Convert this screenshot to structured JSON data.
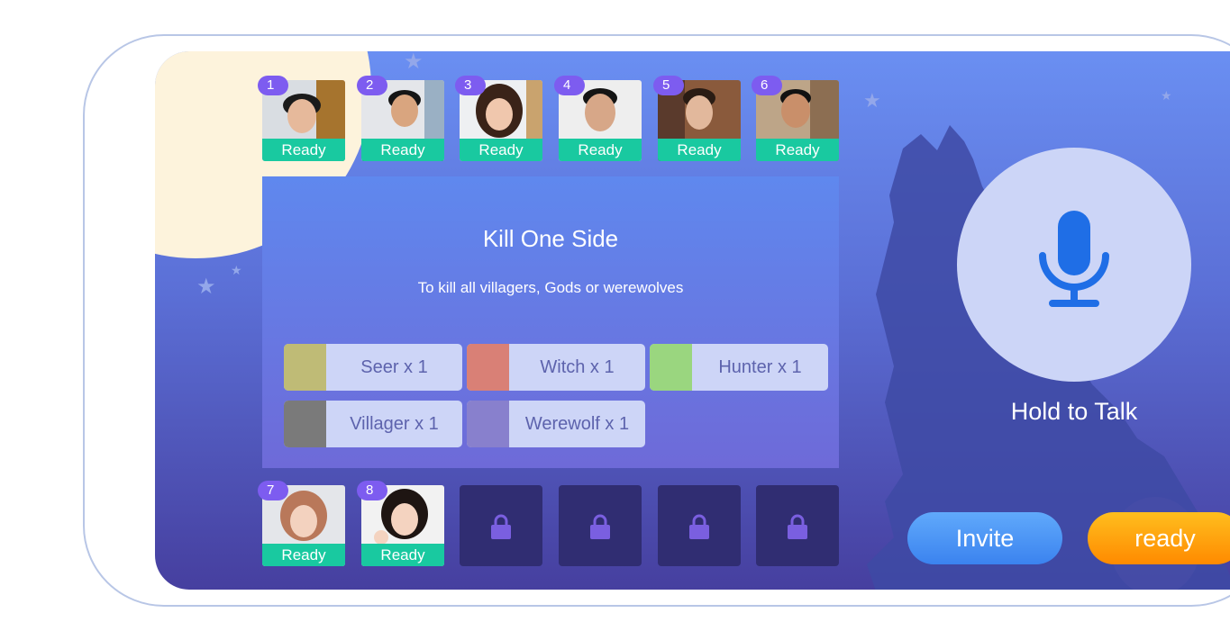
{
  "players_top": [
    {
      "number": "1",
      "status": "Ready"
    },
    {
      "number": "2",
      "status": "Ready"
    },
    {
      "number": "3",
      "status": "Ready"
    },
    {
      "number": "4",
      "status": "Ready"
    },
    {
      "number": "5",
      "status": "Ready"
    },
    {
      "number": "6",
      "status": "Ready"
    }
  ],
  "players_bottom": [
    {
      "number": "7",
      "status": "Ready"
    },
    {
      "number": "8",
      "status": "Ready"
    }
  ],
  "panel": {
    "title": "Kill One Side",
    "subtitle": "To kill all villagers, Gods or werewolves"
  },
  "roles": [
    {
      "label": "Seer x 1",
      "color": "#bfbb76"
    },
    {
      "label": "Witch x 1",
      "color": "#d98076"
    },
    {
      "label": "Hunter x 1",
      "color": "#9ad67f"
    },
    {
      "label": "Villager x 1",
      "color": "#7a7a7a"
    },
    {
      "label": "Werewolf x 1",
      "color": "#8880cd"
    }
  ],
  "talk": {
    "label": "Hold to Talk"
  },
  "buttons": {
    "invite": "Invite",
    "ready": "ready"
  },
  "icons": {
    "mic": "microphone-icon",
    "lock": "lock-icon"
  }
}
